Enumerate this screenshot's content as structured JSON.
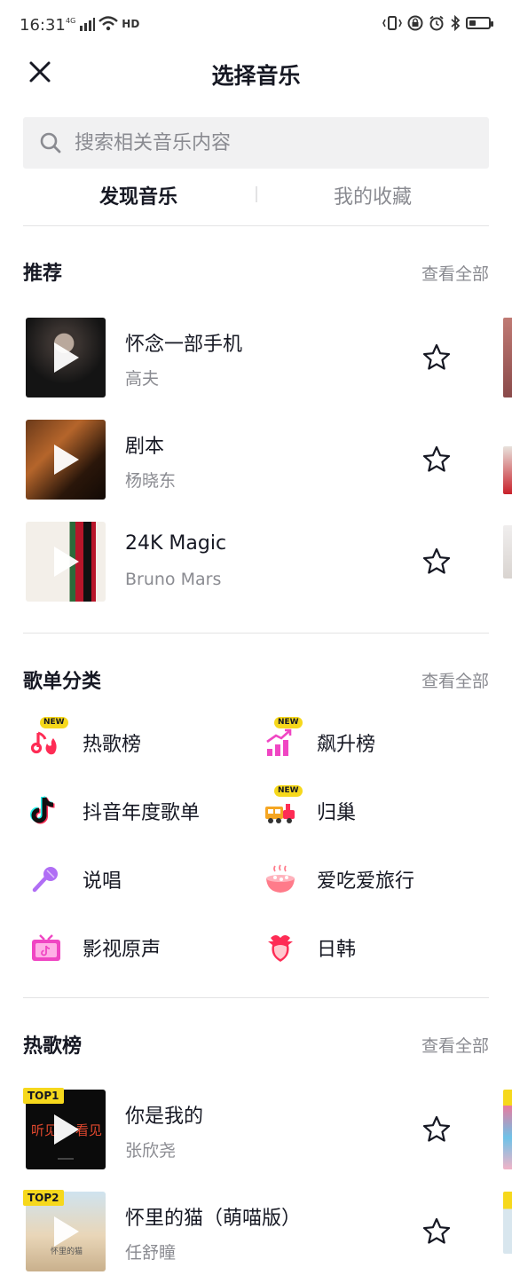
{
  "status_bar": {
    "time": "16:31",
    "network": "4G",
    "hd": "HD",
    "battery_level": 0.35
  },
  "header": {
    "title": "选择音乐",
    "close_icon": "close-icon"
  },
  "search": {
    "placeholder": "搜索相关音乐内容",
    "icon": "search-icon"
  },
  "tabs": [
    {
      "label": "发现音乐",
      "active": true
    },
    {
      "label": "我的收藏",
      "active": false
    }
  ],
  "recommended": {
    "title": "推荐",
    "view_all": "查看全部",
    "songs": [
      {
        "title": "怀念一部手机",
        "artist": "高夫"
      },
      {
        "title": "剧本",
        "artist": "杨晓东"
      },
      {
        "title": "24K Magic",
        "artist": "Bruno Mars"
      }
    ]
  },
  "playlist_categories": {
    "title": "歌单分类",
    "view_all": "查看全部",
    "new_badge": "NEW",
    "items": [
      {
        "label": "热歌榜",
        "icon": "hot-music-icon",
        "new": true
      },
      {
        "label": "飙升榜",
        "icon": "rising-chart-icon",
        "new": true
      },
      {
        "label": "抖音年度歌单",
        "icon": "tiktok-logo-icon",
        "new": false
      },
      {
        "label": "归巢",
        "icon": "train-icon",
        "new": true
      },
      {
        "label": "说唱",
        "icon": "microphone-icon",
        "new": false
      },
      {
        "label": "爱吃爱旅行",
        "icon": "food-bowl-icon",
        "new": false
      },
      {
        "label": "影视原声",
        "icon": "tv-icon",
        "new": false
      },
      {
        "label": "日韩",
        "icon": "heart-character-icon",
        "new": false
      }
    ]
  },
  "hot_chart": {
    "title": "热歌榜",
    "view_all": "查看全部",
    "songs": [
      {
        "title": "你是我的",
        "artist": "张欣尧",
        "rank": "TOP1"
      },
      {
        "title": "怀里的猫（萌喵版）",
        "artist": "任舒瞳",
        "rank": "TOP2"
      }
    ]
  }
}
